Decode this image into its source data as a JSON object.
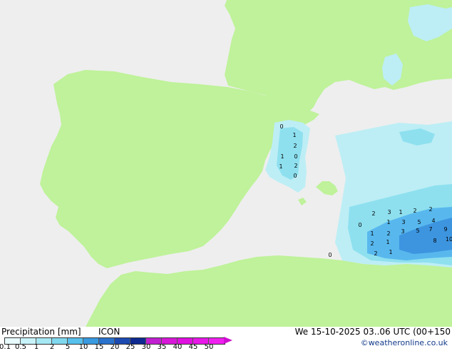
{
  "map": {
    "colors": {
      "land": "#bff29a",
      "sea": "#eeeeee",
      "precip_light": "#bdeef5",
      "precip_mid": "#8ee0ef",
      "precip_high": "#58b8ee",
      "precip_strong": "#3d95e0"
    },
    "precip_values": [
      "0",
      "1",
      "2",
      "1",
      "0",
      "1",
      "2",
      "0",
      "2",
      "3",
      "1",
      "2",
      "2",
      "1",
      "3",
      "5",
      "7",
      "9",
      "10",
      "0",
      "1",
      "2",
      "3",
      "5",
      "4",
      "8",
      "0",
      "2",
      "1",
      "2",
      "1"
    ]
  },
  "footer": {
    "title": "Precipitation [mm]",
    "model": "ICON",
    "valid": "We 15-10-2025 03..06 UTC (00+150",
    "copyright": "©weatheronline.co.uk",
    "scale_labels": [
      "0.1",
      "0.5",
      "1",
      "2",
      "5",
      "10",
      "15",
      "20",
      "25",
      "30",
      "35",
      "40",
      "45",
      "50"
    ],
    "scale_colors": [
      "#e8fbff",
      "#c8f3fb",
      "#a6e8f4",
      "#80d8ee",
      "#58c0ec",
      "#3a9ae0",
      "#2a72cc",
      "#1c4ab0",
      "#0e2a90",
      "#c020d0",
      "#d818d8",
      "#e010e0",
      "#e818e8",
      "#f020f0"
    ]
  }
}
